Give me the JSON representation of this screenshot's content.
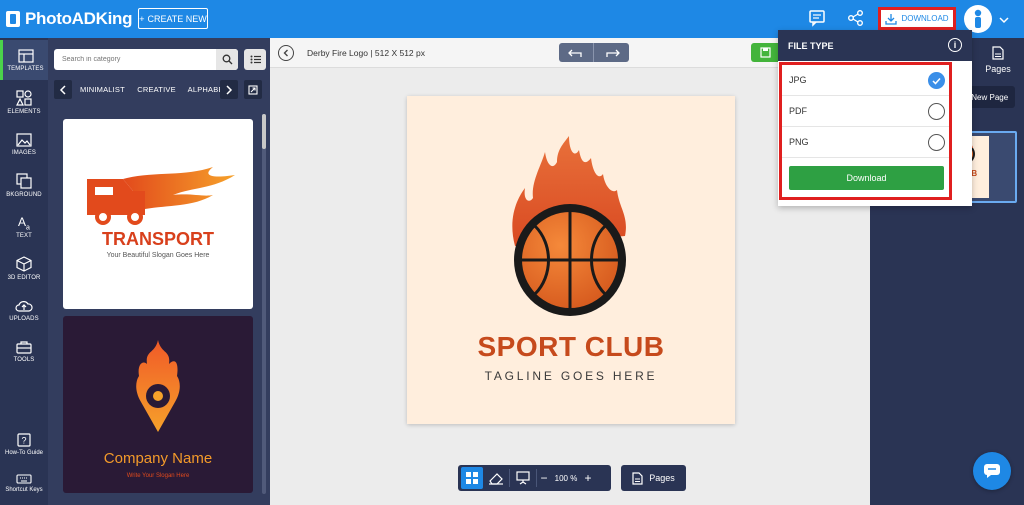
{
  "app": {
    "logo": "PhotoADKing"
  },
  "header": {
    "create_label": "CREATE NEW",
    "download_label": "DOWNLOAD",
    "icons": [
      "chat-icon",
      "share-icon",
      "download-icon",
      "user-icon",
      "chevron-down-icon"
    ]
  },
  "leftnav": {
    "items": [
      {
        "label": "TEMPLATES",
        "icon": "templates-icon"
      },
      {
        "label": "ELEMENTS",
        "icon": "elements-icon"
      },
      {
        "label": "IMAGES",
        "icon": "images-icon"
      },
      {
        "label": "BKGROUND",
        "icon": "background-icon"
      },
      {
        "label": "TEXT",
        "icon": "text-icon"
      },
      {
        "label": "3D EDITOR",
        "icon": "3d-icon"
      },
      {
        "label": "UPLOADS",
        "icon": "upload-icon"
      },
      {
        "label": "TOOLS",
        "icon": "tools-icon"
      }
    ],
    "bottom": [
      {
        "label": "How-To Guide",
        "icon": "guide-icon"
      },
      {
        "label": "Shortcut Keys",
        "icon": "keyboard-icon"
      }
    ]
  },
  "templates": {
    "search_placeholder": "Search in category",
    "categories": [
      "MINIMALIST",
      "CREATIVE",
      "ALPHABET"
    ],
    "card1": {
      "title": "TRANSPORT",
      "slogan": "Your Beautiful Slogan Goes Here"
    },
    "card2": {
      "title": "Company Name",
      "slogan": "Write Your Slogan Here"
    }
  },
  "toolbar": {
    "doc_name": "Derby Fire Logo",
    "doc_size": "512 X 512 px"
  },
  "canvas": {
    "title": "SPORT CLUB",
    "tagline": "TAGLINE GOES HERE",
    "zoom": "100 %",
    "pages_label": "Pages"
  },
  "right_panel": {
    "tab_partial": "or",
    "tab_pages": "Pages",
    "new_page": "New Page"
  },
  "dropdown": {
    "title": "FILE TYPE",
    "options": [
      {
        "label": "JPG",
        "selected": true
      },
      {
        "label": "PDF",
        "selected": false
      },
      {
        "label": "PNG",
        "selected": false
      }
    ],
    "download_button": "Download"
  },
  "colors": {
    "accent": "#1e88e5",
    "nav_bg": "#2a3454",
    "highlight": "#e01f1f",
    "download_green": "#2ea043",
    "brand_orange": "#c64a1c"
  }
}
